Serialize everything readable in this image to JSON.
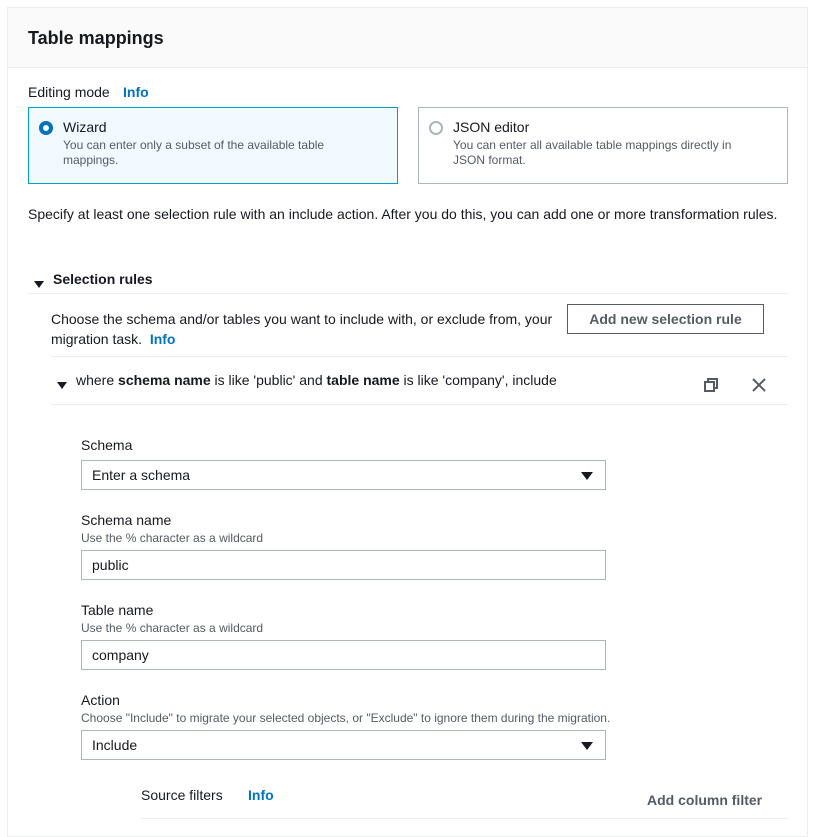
{
  "panel": {
    "title": "Table mappings"
  },
  "editing_mode": {
    "label": "Editing mode",
    "info": "Info",
    "options": [
      {
        "title": "Wizard",
        "description": "You can enter only a subset of the available table mappings.",
        "selected": true
      },
      {
        "title": "JSON editor",
        "description": "You can enter all available table mappings directly in JSON format.",
        "selected": false
      }
    ]
  },
  "intro_text": "Specify at least one selection rule with an include action. After you do this, you can add one or more transformation rules.",
  "selection_rules": {
    "title": "Selection rules",
    "description": "Choose the schema and/or tables you want to include with, or exclude from, your migration task.",
    "info": "Info",
    "add_button": "Add new selection rule",
    "rule": {
      "summary_prefix": "where",
      "summary_schema_key": "schema name",
      "summary_mid1": "is like 'public' and",
      "summary_table_key": "table name",
      "summary_mid2": "is like 'company', include",
      "schema": {
        "label": "Schema",
        "value": "Enter a schema"
      },
      "schema_name": {
        "label": "Schema name",
        "hint": "Use the % character as a wildcard",
        "value": "public"
      },
      "table_name": {
        "label": "Table name",
        "hint": "Use the % character as a wildcard",
        "value": "company"
      },
      "action": {
        "label": "Action",
        "hint": "Choose \"Include\" to migrate your selected objects, or \"Exclude\" to ignore them during the migration.",
        "value": "Include"
      },
      "source_filters": {
        "label": "Source filters",
        "info": "Info",
        "add_button": "Add column filter"
      }
    }
  },
  "icons": {
    "copy": "copy-icon",
    "close": "close-icon",
    "caret": "caret-down-icon"
  },
  "colors": {
    "accent": "#0073bb",
    "selected_bg": "#f1faff",
    "border": "#aab7b8",
    "header_bg": "#fafafa"
  }
}
